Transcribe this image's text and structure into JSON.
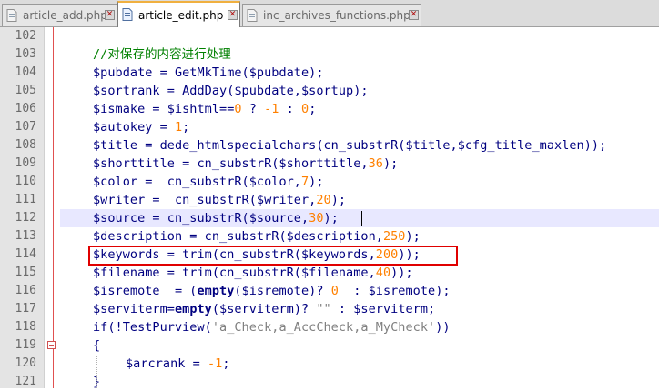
{
  "tabs": [
    {
      "label": "article_add.php",
      "active": false,
      "close": "✕"
    },
    {
      "label": "article_edit.php",
      "active": true,
      "close": "✕"
    },
    {
      "label": "inc_archives_functions.php",
      "active": false,
      "close": "✕"
    }
  ],
  "editor": {
    "lines": [
      {
        "num": "102"
      },
      {
        "num": "103",
        "text": "//对保存的内容进行处理"
      },
      {
        "num": "104",
        "text": "$pubdate = GetMkTime($pubdate);"
      },
      {
        "num": "105",
        "text": "$sortrank = AddDay($pubdate,$sortup);"
      },
      {
        "num": "106",
        "text": "$ismake = $ishtml==0 ? -1 : 0;"
      },
      {
        "num": "107",
        "text": "$autokey = 1;"
      },
      {
        "num": "108",
        "text": "$title = dede_htmlspecialchars(cn_substrR($title,$cfg_title_maxlen));"
      },
      {
        "num": "109",
        "text": "$shorttitle = cn_substrR($shorttitle,36);"
      },
      {
        "num": "110",
        "text": "$color =  cn_substrR($color,7);"
      },
      {
        "num": "111",
        "text": "$writer =  cn_substrR($writer,20);"
      },
      {
        "num": "112",
        "text": "$source = cn_substrR($source,30);"
      },
      {
        "num": "113",
        "text": "$description = cn_substrR($description,250);"
      },
      {
        "num": "114",
        "text": "$keywords = trim(cn_substrR($keywords,200));"
      },
      {
        "num": "115",
        "text": "$filename = trim(cn_substrR($filename,40));"
      },
      {
        "num": "116",
        "text": "$isremote  = (empty($isremote)? 0  : $isremote);"
      },
      {
        "num": "117",
        "text": "$serviterm=empty($serviterm)? \"\" : $serviterm;"
      },
      {
        "num": "118",
        "text": "if(!TestPurview('a_Check,a_AccCheck,a_MyCheck'))"
      },
      {
        "num": "119",
        "text": "{"
      },
      {
        "num": "120",
        "text": "$arcrank = -1;"
      },
      {
        "num": "121",
        "text": "}"
      }
    ],
    "current_line": "112",
    "highlighted_line": "114"
  },
  "colors": {
    "highlight_box": "#e00000",
    "number": "#ff8000",
    "comment": "#008000",
    "variable": "#000080",
    "string": "#808080"
  }
}
